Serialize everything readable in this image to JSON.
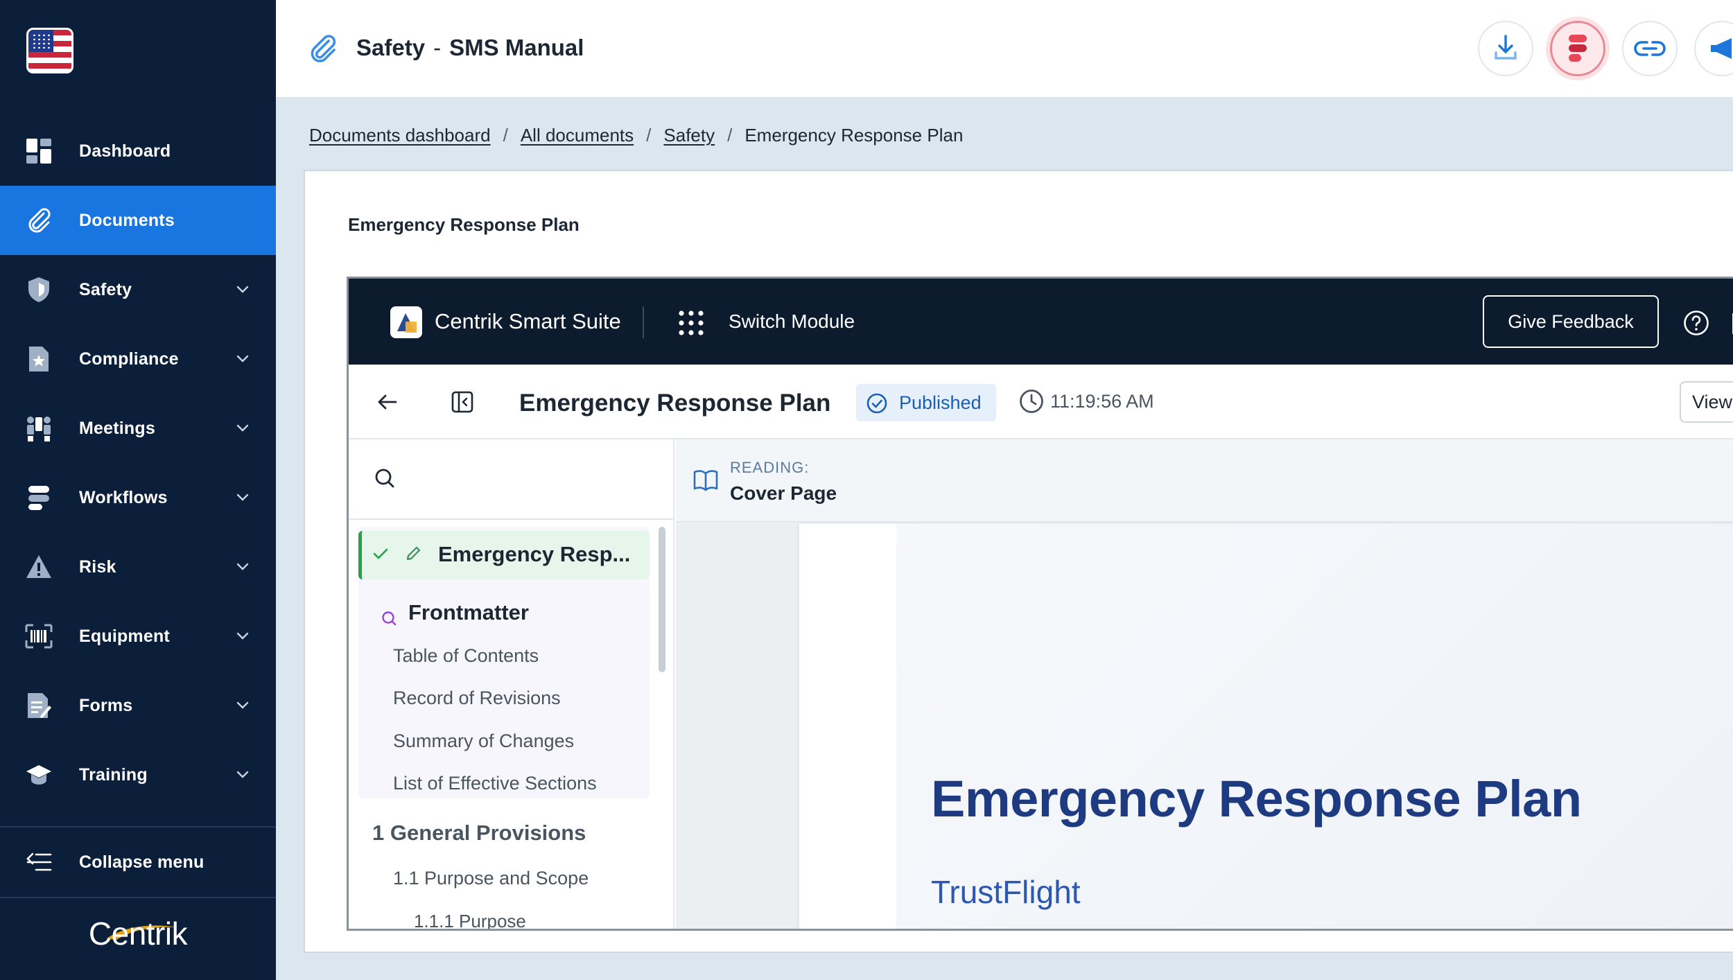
{
  "sidebar": {
    "items": [
      {
        "label": "Dashboard",
        "icon": "dashboard-icon",
        "active": false,
        "expandable": false
      },
      {
        "label": "Documents",
        "icon": "paperclip-icon",
        "active": true,
        "expandable": false
      },
      {
        "label": "Safety",
        "icon": "shield-icon",
        "active": false,
        "expandable": true
      },
      {
        "label": "Compliance",
        "icon": "document-star-icon",
        "active": false,
        "expandable": true
      },
      {
        "label": "Meetings",
        "icon": "meeting-icon",
        "active": false,
        "expandable": true
      },
      {
        "label": "Workflows",
        "icon": "workflow-icon",
        "active": false,
        "expandable": true
      },
      {
        "label": "Risk",
        "icon": "warning-icon",
        "active": false,
        "expandable": true
      },
      {
        "label": "Equipment",
        "icon": "barcode-icon",
        "active": false,
        "expandable": true
      },
      {
        "label": "Forms",
        "icon": "form-icon",
        "active": false,
        "expandable": true
      },
      {
        "label": "Training",
        "icon": "graduation-cap-icon",
        "active": false,
        "expandable": true
      }
    ],
    "collapse_label": "Collapse menu",
    "brand": "Centrik"
  },
  "topbar": {
    "section": "Safety",
    "separator": "-",
    "manual": "SMS Manual",
    "actions": [
      "download-icon",
      "stack-icon",
      "link-icon",
      "megaphone-icon"
    ]
  },
  "breadcrumb": {
    "items": [
      "Documents dashboard",
      "All documents",
      "Safety"
    ],
    "current": "Emergency Response Plan"
  },
  "card": {
    "title": "Emergency Response Plan"
  },
  "app": {
    "name": "Centrik Smart Suite",
    "switch_label": "Switch Module",
    "feedback_label": "Give Feedback",
    "doc_title": "Emergency Response Plan",
    "status": "Published",
    "time": "11:19:56 AM",
    "view_label": "View",
    "colors": {
      "header": "#0d1b2e",
      "status": "#1a5fb4",
      "active_row": "#22a24a",
      "title": "#1e3a80"
    }
  },
  "tree": {
    "active": "Emergency Resp...",
    "group_title": "Frontmatter",
    "group_items": [
      "Table of Contents",
      "Record of Revisions",
      "Summary of Changes",
      "List of Effective Sections"
    ],
    "section": "1 General Provisions",
    "sub": "1.1 Purpose and Scope",
    "subsub": "1.1.1 Purpose"
  },
  "reader": {
    "label": "READING:",
    "value": "Cover Page",
    "page_title": "Emergency Response Plan",
    "page_subtitle": "TrustFlight"
  }
}
